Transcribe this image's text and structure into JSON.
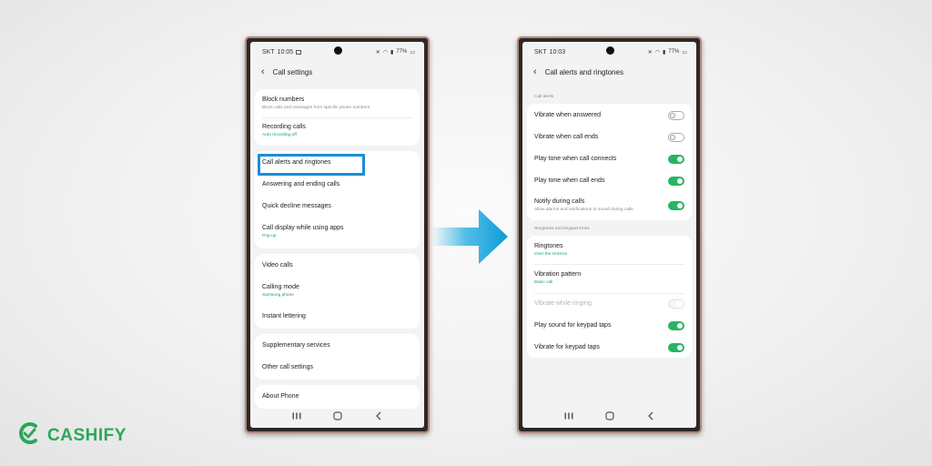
{
  "left_phone": {
    "status": {
      "carrier": "SKT",
      "time": "10:05",
      "battery": "77%"
    },
    "title": "Call settings",
    "items": [
      {
        "title": "Block numbers",
        "subtitle": "Block calls and messages from specific phone numbers."
      },
      {
        "title": "Recording calls",
        "subtitle": "Auto recording off"
      },
      {
        "title": "Call alerts and ringtones"
      },
      {
        "title": "Answering and ending calls"
      },
      {
        "title": "Quick decline messages"
      },
      {
        "title": "Call display while using apps",
        "subtitle": "Pop-up"
      },
      {
        "title": "Video calls"
      },
      {
        "title": "Calling mode",
        "subtitle": "Samsung phone"
      },
      {
        "title": "Instant lettering"
      },
      {
        "title": "Supplementary services"
      },
      {
        "title": "Other call settings"
      },
      {
        "title": "About Phone"
      }
    ]
  },
  "right_phone": {
    "status": {
      "carrier": "SKT",
      "time": "10:03",
      "battery": "77%"
    },
    "title": "Call alerts and ringtones",
    "section_call_alerts": "Call alerts",
    "section_ringtones": "Ringtones and keypad tones",
    "items": [
      {
        "title": "Vibrate when answered",
        "toggle": "off"
      },
      {
        "title": "Vibrate when call ends",
        "toggle": "off"
      },
      {
        "title": "Play tone when call connects",
        "toggle": "on"
      },
      {
        "title": "Play tone when call ends",
        "toggle": "on"
      },
      {
        "title": "Notify during calls",
        "subtitle": "Allow alarms and notifications to sound during calls.",
        "toggle": "on"
      },
      {
        "title": "Ringtones",
        "subtitle": "Over the Horizon"
      },
      {
        "title": "Vibration pattern",
        "subtitle": "Basic call"
      },
      {
        "title": "Vibrate while ringing",
        "toggle": "disabled"
      },
      {
        "title": "Play sound for keypad taps",
        "toggle": "on"
      },
      {
        "title": "Vibrate for keypad taps",
        "toggle": "on"
      }
    ]
  },
  "icons": {
    "nav": [
      "recent-apps-icon",
      "home-icon",
      "back-icon"
    ],
    "arrow": "arrow-right-icon",
    "logo": "cashify-logo-icon"
  },
  "brand": {
    "name": "CASHIFY",
    "color": "#2ba85a"
  },
  "colors": {
    "toggle_on": "#29b464",
    "highlight": "#1a8ed6",
    "arrow": "#1aa9e2",
    "subtitle_green": "#1e9e62"
  }
}
